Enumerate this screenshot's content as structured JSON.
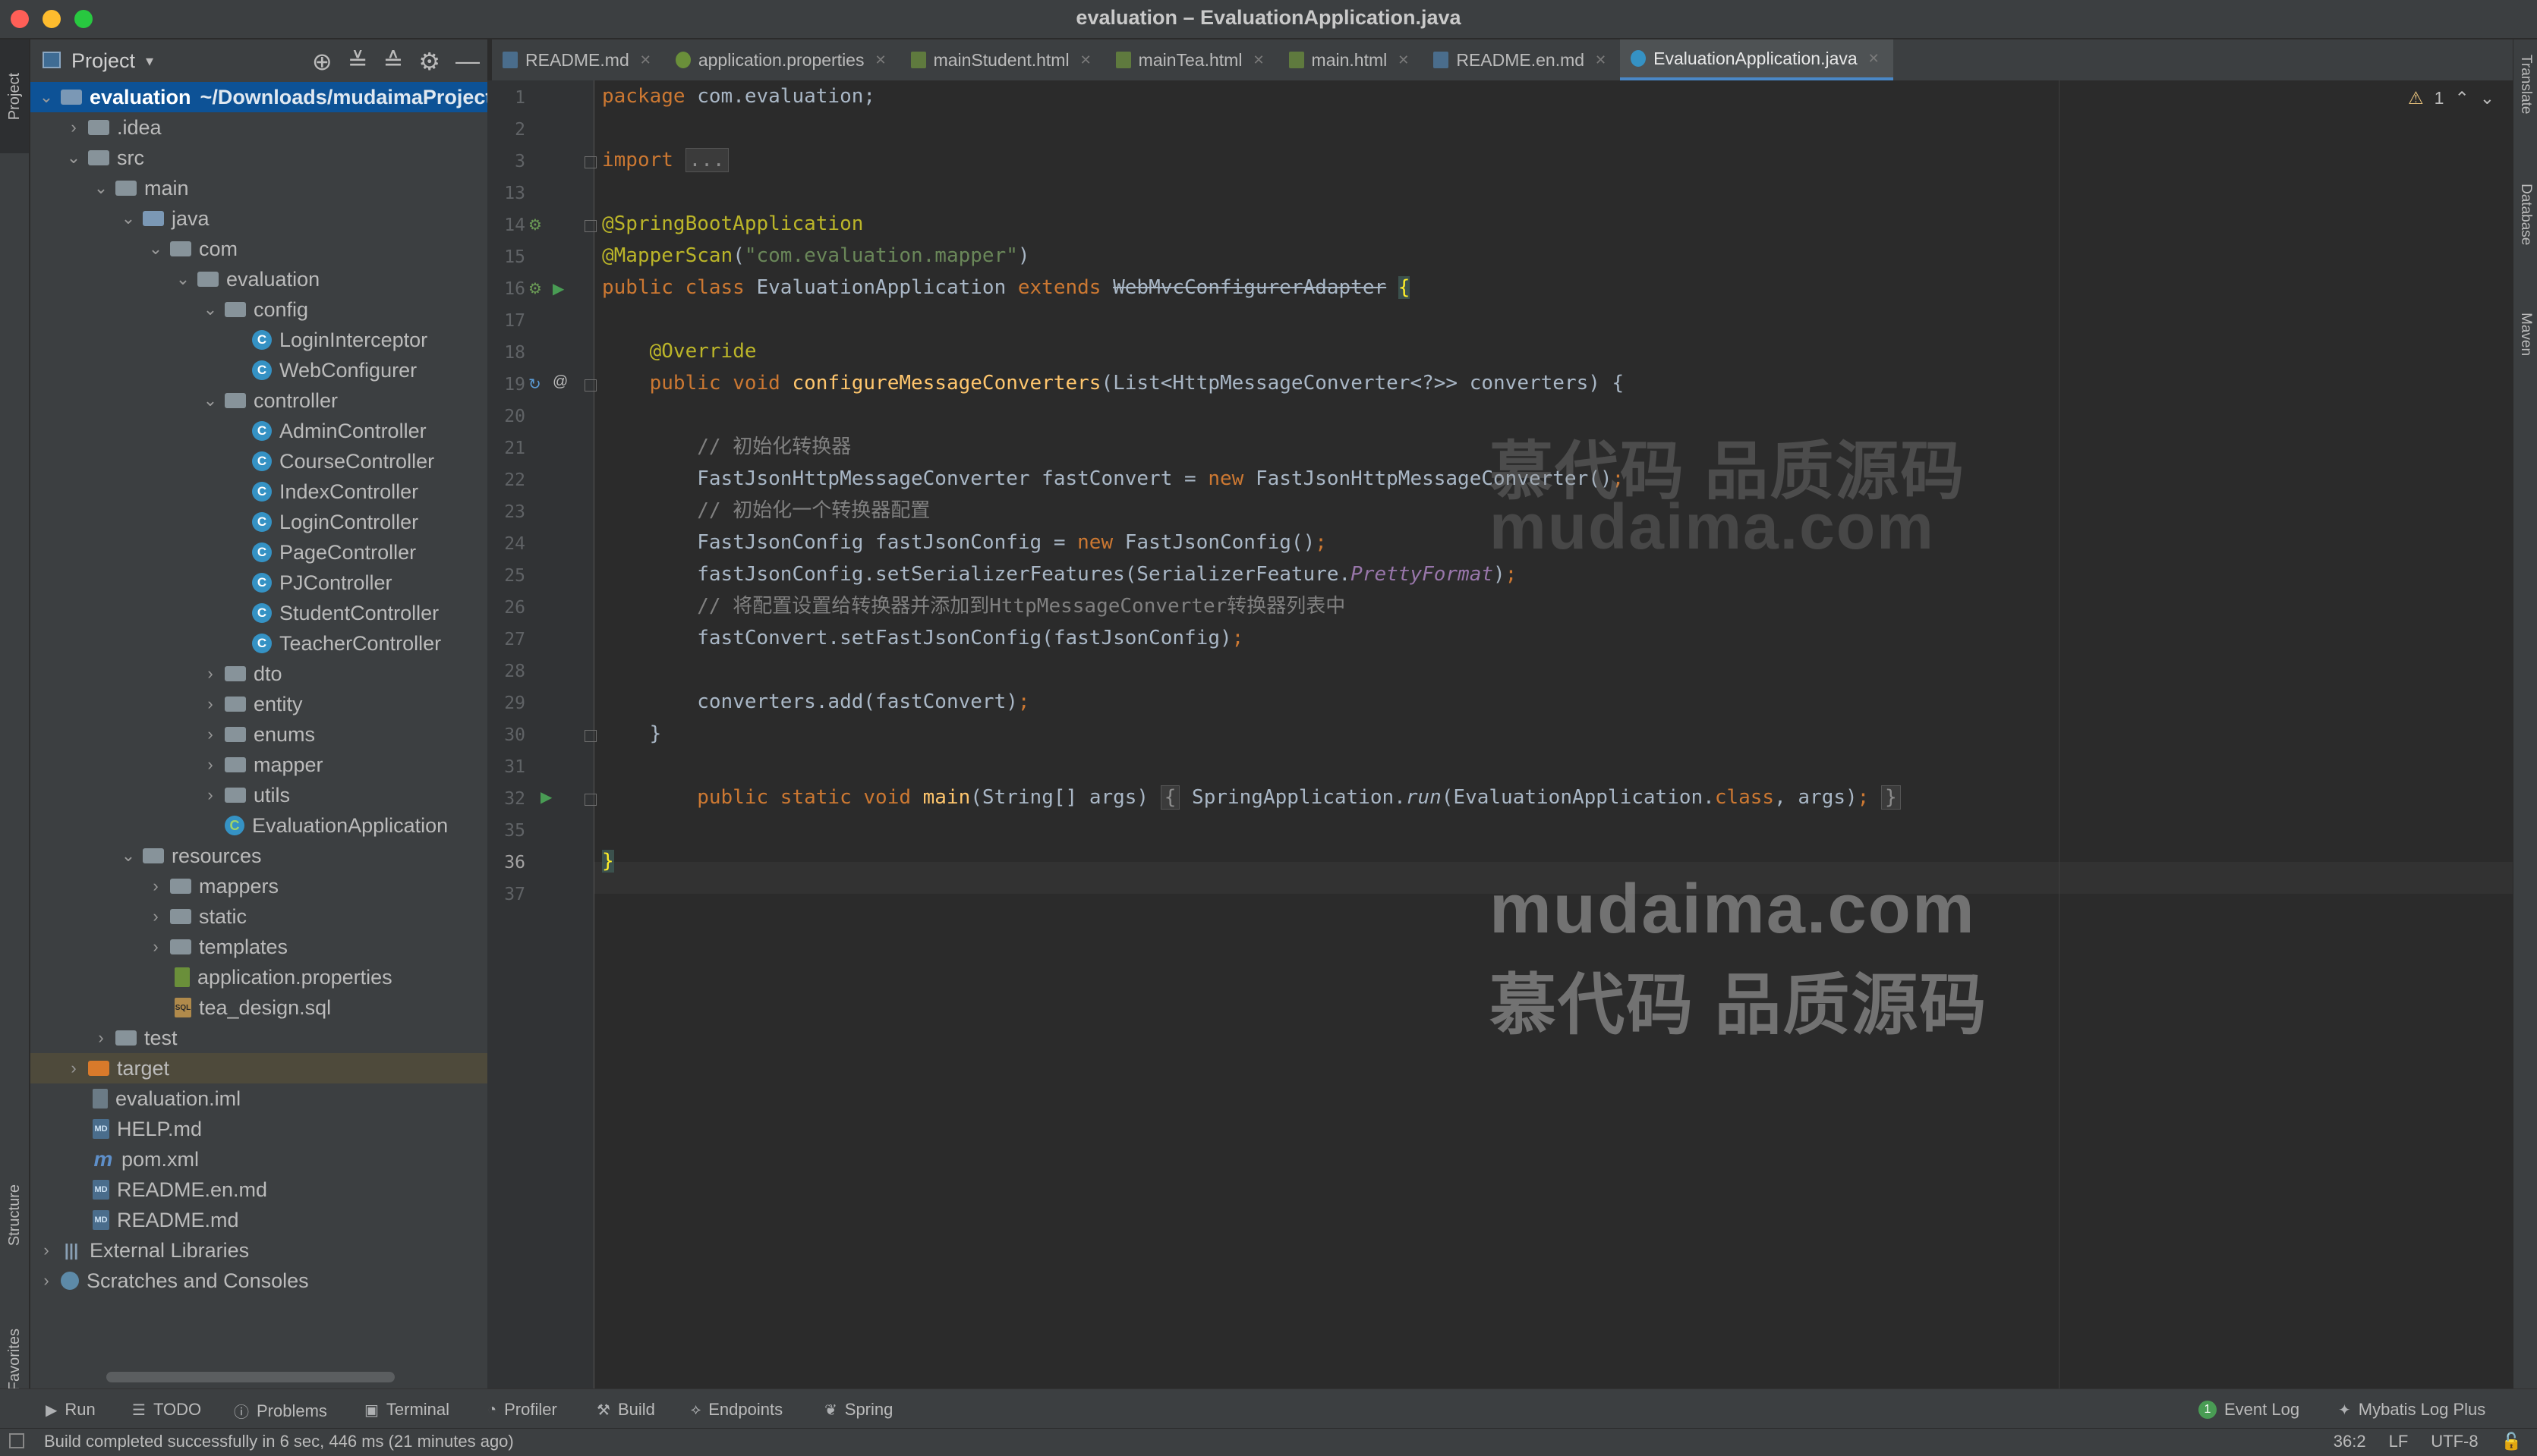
{
  "window": {
    "title": "evaluation – EvaluationApplication.java"
  },
  "left_strip": {
    "project": "Project",
    "structure": "Structure",
    "favorites": "Favorites"
  },
  "right_strip": {
    "translate": "Translate",
    "database": "Database",
    "maven": "Maven"
  },
  "project_panel": {
    "title": "Project",
    "root_name": "evaluation",
    "root_path": "~/Downloads/mudaimaProject",
    "nodes": {
      "idea": ".idea",
      "src": "src",
      "main": "main",
      "java": "java",
      "com": "com",
      "evaluation": "evaluation",
      "config": "config",
      "LoginInterceptor": "LoginInterceptor",
      "WebConfigurer": "WebConfigurer",
      "controller": "controller",
      "AdminController": "AdminController",
      "CourseController": "CourseController",
      "IndexController": "IndexController",
      "LoginController": "LoginController",
      "PageController": "PageController",
      "PJController": "PJController",
      "StudentController": "StudentController",
      "TeacherController": "TeacherController",
      "dto": "dto",
      "entity": "entity",
      "enums": "enums",
      "mapper": "mapper",
      "utils": "utils",
      "EvaluationApplication": "EvaluationApplication",
      "resources": "resources",
      "mappers": "mappers",
      "static": "static",
      "templates": "templates",
      "application_properties": "application.properties",
      "tea_design": "tea_design.sql",
      "test": "test",
      "target": "target",
      "evaluation_iml": "evaluation.iml",
      "help_md": "HELP.md",
      "pom": "pom.xml",
      "readme_en": "README.en.md",
      "readme": "README.md",
      "external_libraries": "External Libraries",
      "scratches": "Scratches and Consoles"
    }
  },
  "tabs": [
    {
      "label": "README.md"
    },
    {
      "label": "application.properties"
    },
    {
      "label": "mainStudent.html"
    },
    {
      "label": "mainTea.html"
    },
    {
      "label": "main.html"
    },
    {
      "label": "README.en.md"
    },
    {
      "label": "EvaluationApplication.java"
    }
  ],
  "editor": {
    "warnings": "1",
    "lines": {
      "l1": "1",
      "l2": "2",
      "l3": "3",
      "l13": "13",
      "l14": "14",
      "l15": "15",
      "l16": "16",
      "l17": "17",
      "l18": "18",
      "l19": "19",
      "l20": "20",
      "l21": "21",
      "l22": "22",
      "l23": "23",
      "l24": "24",
      "l25": "25",
      "l26": "26",
      "l27": "27",
      "l28": "28",
      "l29": "29",
      "l30": "30",
      "l31": "31",
      "l32": "32",
      "l35": "35",
      "l36": "36",
      "l37": "37"
    },
    "code": {
      "c1_kw": "package",
      "c1_rest": " com.evaluation;",
      "c3_kw": "import",
      "c3_fold": "...",
      "c14": "@SpringBootApplication",
      "c15_ann": "@MapperScan",
      "c15_p1": "(",
      "c15_str": "\"com.evaluation.mapper\"",
      "c15_p2": ")",
      "c16_kw": "public class",
      "c16_name": " EvaluationApplication ",
      "c16_kw2": "extends",
      "c16_sp": " ",
      "c16_strike": "WebMvcConfigurerAdapter",
      "c16_sp2": " ",
      "c16_brace": "{",
      "c18": "@Override",
      "c19_kw": "public void",
      "c19_sp": " ",
      "c19_fn": "configureMessageConverters",
      "c19_rest": "(List<HttpMessageConverter<?>> converters) {",
      "c21": "// 初始化转换器",
      "c22_a": "FastJsonHttpMessageConverter fastConvert = ",
      "c22_kw": "new",
      "c22_b": " FastJsonHttpMessageConverter()",
      "c22_semi": ";",
      "c23": "// 初始化一个转换器配置",
      "c24_a": "FastJsonConfig fastJsonConfig = ",
      "c24_kw": "new",
      "c24_b": " FastJsonConfig()",
      "c24_semi": ";",
      "c25_a": "fastJsonConfig.setSerializerFeatures(SerializerFeature.",
      "c25_i": "PrettyFormat",
      "c25_b": ")",
      "c25_semi": ";",
      "c26": "// 将配置设置给转换器并添加到HttpMessageConverter转换器列表中",
      "c27_a": "fastConvert.setFastJsonConfig(fastJsonConfig)",
      "c27_semi": ";",
      "c29_a": "converters.add(fastConvert)",
      "c29_semi": ";",
      "c30": "}",
      "c32_kw": "public static void",
      "c32_sp": " ",
      "c32_fn": "main",
      "c32_a": "(String[] args) ",
      "c32_f1": "{",
      "c32_b": " SpringApplication.",
      "c32_run": "run",
      "c32_c": "(EvaluationApplication.",
      "c32_kw2": "class",
      "c32_d": ", args)",
      "c32_semi": ";",
      "c32_sp2": " ",
      "c32_f2": "}",
      "c36": "}"
    }
  },
  "watermark": {
    "top_cn": "慕代码 品质源码",
    "top_en": "mudaima.com",
    "bottom_en": "mudaima.com",
    "bottom_cn": "慕代码 品质源码"
  },
  "toolwindows": {
    "run": "Run",
    "todo": "TODO",
    "problems": "Problems",
    "terminal": "Terminal",
    "profiler": "Profiler",
    "build": "Build",
    "endpoints": "Endpoints",
    "spring": "Spring",
    "event_log": "Event Log",
    "event_log_count": "1",
    "mybatis": "Mybatis Log Plus"
  },
  "status": {
    "message": "Build completed successfully in 6 sec, 446 ms (21 minutes ago)",
    "position": "36:2",
    "line_sep": "LF",
    "encoding": "UTF-8"
  }
}
